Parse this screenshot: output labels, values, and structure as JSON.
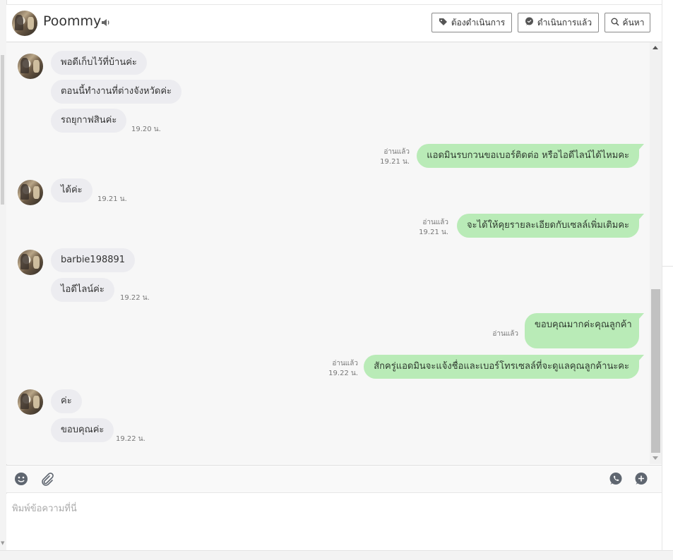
{
  "header": {
    "contact_name": "Poommy",
    "buttons": {
      "pending": "ต้องดำเนินการ",
      "done": "ดำเนินการแล้ว",
      "search": "ค้นหา"
    }
  },
  "messages": {
    "m1": "พอดีเก็บไว้ที่บ้านค่ะ",
    "m2": "ตอนนี้ทำงานที่ต่างจังหวัดค่ะ",
    "m3": "รถยุกาฟสินค่ะ",
    "m3_time": "19.20 น.",
    "m4": "แอดมินรบกวนขอเบอร์ติดต่อ หรือไอดีไลน์ได้ไหมคะ",
    "m4_read": "อ่านแล้ว",
    "m4_time": "19.21 น.",
    "m5": "ได้ค่ะ",
    "m5_time": "19.21 น.",
    "m6": "จะได้ให้คุยรายละเอียดกับเซลล์เพิ่มเติมคะ",
    "m6_read": "อ่านแล้ว",
    "m6_time": "19.21 น.",
    "m7": "barbie198891",
    "m8": "ไอดีไลน์ค่ะ",
    "m8_time": "19.22 น.",
    "m9": "ขอบคุณมากค่ะคุณลูกค้า",
    "m9_read": "อ่านแล้ว",
    "m10": "สักครู่แอดมินจะแจ้งชื่อและเบอร์โทรเซลล์ที่จะดูแลคุณลูกค้านะคะ",
    "m10_read": "อ่านแล้ว",
    "m10_time": "19.22 น.",
    "m11": "ค่ะ",
    "m12": "ขอบคุณค่ะ",
    "m12_time": "19.22 น."
  },
  "composer": {
    "placeholder": "พิมพ์ข้อความที่นี่"
  },
  "icons": {
    "speaker": "speaker-icon",
    "pending": "tag-icon",
    "done": "chat-bubble-icon",
    "search": "search-icon",
    "emoji": "emoji-icon",
    "attach": "paperclip-icon",
    "whatsapp": "phone-chat-icon",
    "add_chat": "add-chat-icon"
  },
  "colors": {
    "outgoing_bubble": "#b9ebb7",
    "incoming_bubble": "#ececf0",
    "chat_background": "#f7f7f7"
  }
}
